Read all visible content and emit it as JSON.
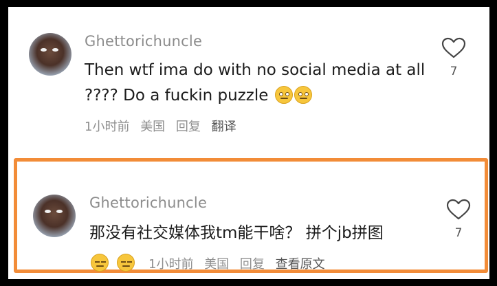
{
  "comments": [
    {
      "username": "Ghettorichuncle",
      "text": "Then wtf ima do with no social media at all ???? Do a fuckin puzzle",
      "text_emoji": "face-with-rolling-eyes",
      "time": "1小时前",
      "location": "美国",
      "reply_label": "回复",
      "action_label": "翻译",
      "likes": "7",
      "highlighted": false
    },
    {
      "username": "Ghettorichuncle",
      "text": "那没有社交媒体我tm能干啥？ 拼个jb拼图",
      "text_emoji": "expressionless-face",
      "time": "1小时前",
      "location": "美国",
      "reply_label": "回复",
      "action_label": "查看原文",
      "likes": "7",
      "highlighted": true
    }
  ],
  "colors": {
    "highlight_border": "#f28c38",
    "background": "#ffffff",
    "username": "#8c8c8c",
    "text": "#1c1c1c",
    "meta": "#8f8f8f"
  }
}
